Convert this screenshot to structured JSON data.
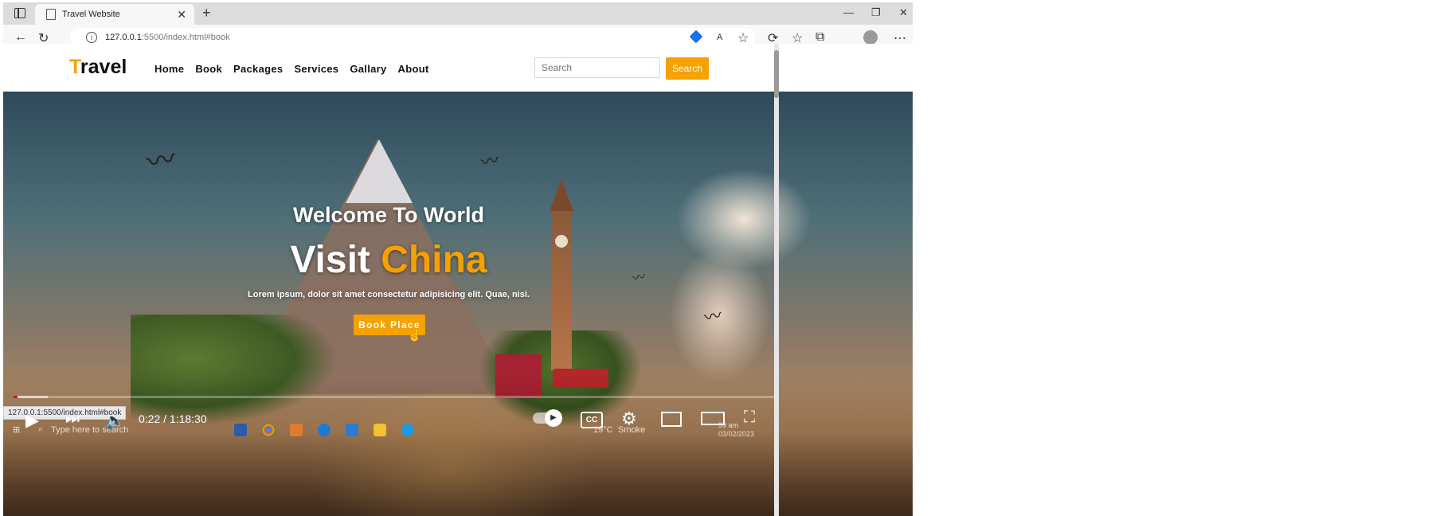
{
  "browser": {
    "tab_title": "Travel Website",
    "url_host": "127.0.0.1",
    "url_path": ":5500/index.html#book"
  },
  "site": {
    "logo_first": "T",
    "logo_rest": "ravel",
    "nav": [
      "Home",
      "Book",
      "Packages",
      "Services",
      "Gallary",
      "About"
    ],
    "search_placeholder": "Search",
    "search_button": "Search"
  },
  "hero": {
    "welcome": "Welcome To World",
    "visit": "Visit",
    "destination": "China",
    "lorem": "Lorem ipsum, dolor sit amet consectetur adipisicing elit. Quae, nisi.",
    "cta": "Book Place"
  },
  "video": {
    "status_url": "127.0.0.1:5500/index.html#book",
    "time": "0:22 / 1:18:30",
    "played_fraction": 0.005,
    "buffered_fraction": 0.045,
    "cc_label": "CC"
  },
  "taskbar": {
    "search_text": "Type here to search",
    "temperature": "19°C",
    "weather": "Smoke",
    "time": "39 am",
    "date": "03/02/2023"
  },
  "colors": {
    "accent": "#f5a100",
    "progress": "#ff0000"
  }
}
